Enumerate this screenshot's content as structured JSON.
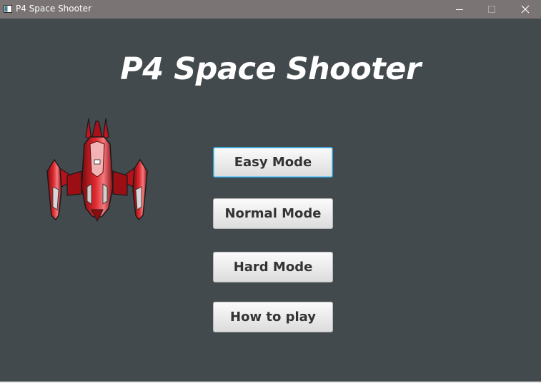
{
  "window": {
    "title": "P4 Space Shooter",
    "controls": [
      "minimize-icon",
      "maximize-icon",
      "close-icon"
    ]
  },
  "main": {
    "heading": "P4 Space Shooter",
    "ship_icon": "red-spaceship-icon",
    "buttons": {
      "easy": "Easy Mode",
      "normal": "Normal Mode",
      "hard": "Hard Mode",
      "howto": "How to play"
    },
    "focused_button": "easy"
  },
  "colors": {
    "background": "#434a4e",
    "titlebar": "#7a7574",
    "focus_ring": "#2b9bd1",
    "ship_red": "#c4141c"
  }
}
